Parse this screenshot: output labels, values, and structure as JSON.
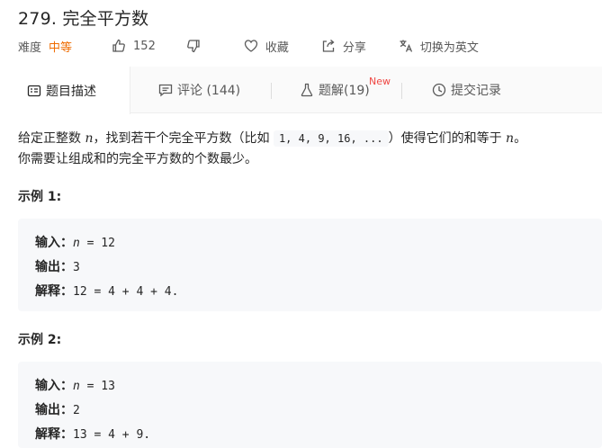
{
  "problem": {
    "title": "279. 完全平方数",
    "difficulty_label": "难度",
    "difficulty": "中等",
    "likes": "152",
    "favorite_label": "收藏",
    "share_label": "分享",
    "lang_switch_label": "切换为英文"
  },
  "tabs": [
    {
      "label": "题目描述",
      "icon": "description-icon"
    },
    {
      "label": "评论 (144)",
      "icon": "comment-icon"
    },
    {
      "label": "题解(19)",
      "icon": "flask-icon",
      "badge": "New"
    },
    {
      "label": "提交记录",
      "icon": "clock-icon"
    }
  ],
  "description": {
    "part1": "给定正整数 ",
    "var_n": "n",
    "part2": "，找到若干个完全平方数（比如 ",
    "seq": [
      "1",
      "4",
      "9",
      "16",
      "..."
    ],
    "part3": "）使得它们的和等于 ",
    "part4": "。",
    "line2": "你需要让组成和的完全平方数的个数最少。"
  },
  "examples": [
    {
      "title": "示例 1:",
      "input_label": "输入：",
      "input_var": "n",
      "input_rest": " = 12",
      "output_label": "输出：",
      "output": "3",
      "explain_label": "解释：",
      "explain": "12 = 4 + 4 + 4."
    },
    {
      "title": "示例 2:",
      "input_label": "输入：",
      "input_var": "n",
      "input_rest": " = 13",
      "output_label": "输出：",
      "output": "2",
      "explain_label": "解释：",
      "explain": "13 = 4 + 9."
    }
  ],
  "colors": {
    "difficulty_medium": "#ef6c00",
    "new_badge": "#ef4743",
    "code_bg": "#f7f8fa"
  }
}
